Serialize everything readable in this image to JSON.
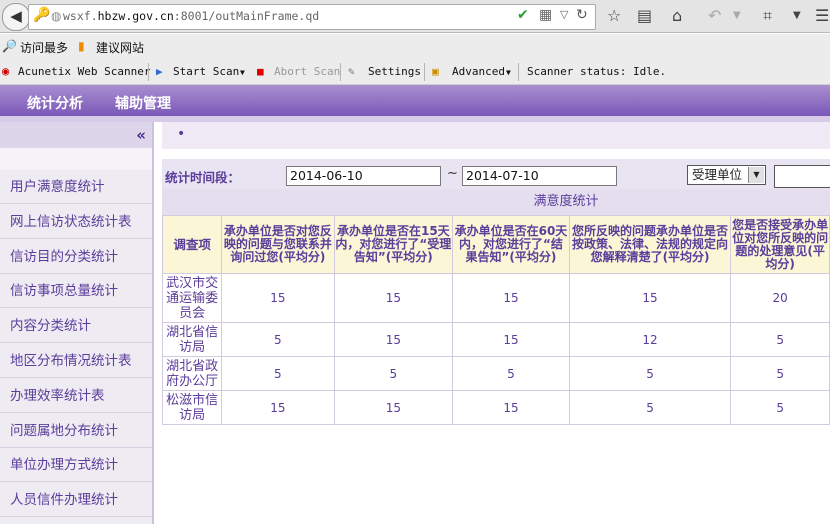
{
  "browser": {
    "url_prefix": "wsxf.",
    "url_domain": "hbzw.gov.cn",
    "url_suffix": ":8001/outMainFrame.qd",
    "bookmarks": [
      "访问最多",
      "建议网站"
    ],
    "icons": [
      "back-icon",
      "security-key-icon",
      "globe-icon",
      "shield-check-icon",
      "qr-icon",
      "dropdown-icon",
      "refresh-icon",
      "star-icon",
      "reader-icon",
      "home-icon",
      "undo-icon",
      "crop-icon",
      "menu-icon"
    ]
  },
  "acunetix": {
    "title": "Acunetix Web Scanner",
    "start_scan": "Start Scan",
    "abort_scan": "Abort Scan",
    "settings": "Settings",
    "advanced": "Advanced",
    "status": "Scanner status: Idle."
  },
  "app_menu": [
    "统计分析",
    "辅助管理"
  ],
  "leftnav": {
    "collapse": "«",
    "items": [
      "用户满意度统计",
      "网上信访状态统计表",
      "信访目的分类统计",
      "信访事项总量统计",
      "内容分类统计",
      "地区分布情况统计表",
      "办理效率统计表",
      "问题属地分布统计",
      "单位办理方式统计",
      "人员信件办理统计"
    ]
  },
  "main": {
    "crumb": "•",
    "filter_label": "统计时间段：",
    "date_from": "2014-06-10",
    "tilde": "~",
    "date_to": "2014-07-10",
    "select_value": "受理单位",
    "table_title": "满意度统计",
    "headers": [
      "调查项",
      "承办单位是否对您反映的问题与您联系并询问过您(平均分)",
      "承办单位是否在15天内，对您进行了“受理告知”(平均分)",
      "承办单位是否在60天内，对您进行了“结果告知”(平均分)",
      "您所反映的问题承办单位是否按政策、法律、法规的规定向您解释清楚了(平均分)",
      "您是否接受承办单位对您所反映的问题的处理意见(平均分)"
    ],
    "rows": [
      {
        "dept": "武汉市交通运输委员会",
        "values": [
          "15",
          "15",
          "15",
          "15",
          "20"
        ]
      },
      {
        "dept": "湖北省信访局",
        "values": [
          "5",
          "15",
          "15",
          "12",
          "5"
        ]
      },
      {
        "dept": "湖北省政府办公厅",
        "values": [
          "5",
          "5",
          "5",
          "5",
          "5"
        ]
      },
      {
        "dept": "松滋市信访局",
        "values": [
          "15",
          "15",
          "15",
          "5",
          "5"
        ]
      }
    ]
  }
}
